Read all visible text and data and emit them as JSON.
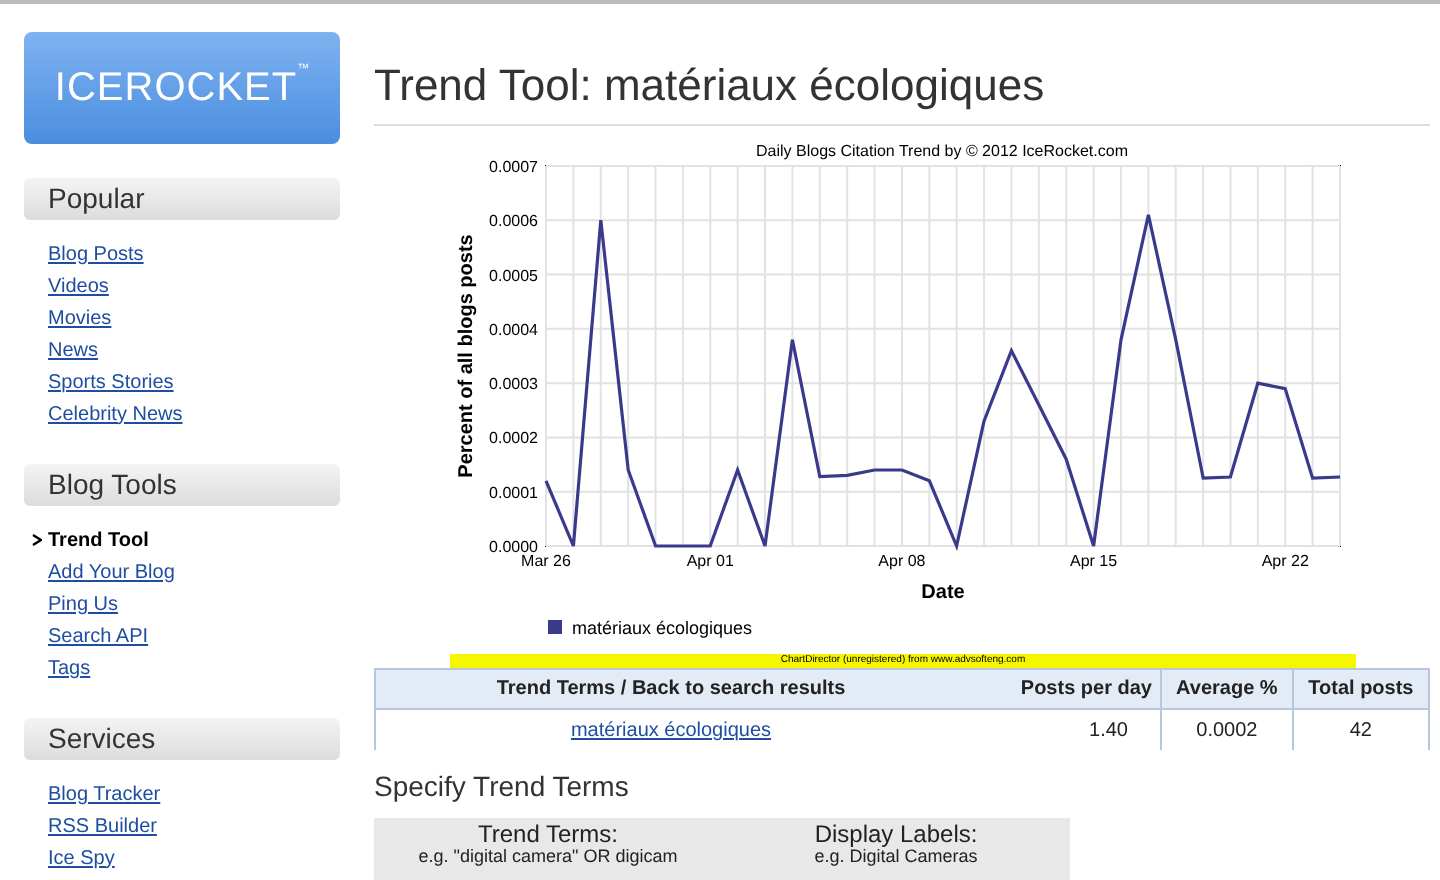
{
  "logo": {
    "text": "ICEROCKET",
    "mark": "™"
  },
  "sidebar": {
    "sections": [
      {
        "title": "Popular",
        "items": [
          {
            "label": "Blog Posts",
            "selected": false
          },
          {
            "label": "Videos",
            "selected": false
          },
          {
            "label": "Movies",
            "selected": false
          },
          {
            "label": "News",
            "selected": false
          },
          {
            "label": "Sports Stories",
            "selected": false
          },
          {
            "label": "Celebrity News",
            "selected": false
          }
        ]
      },
      {
        "title": "Blog Tools",
        "items": [
          {
            "label": "Trend Tool",
            "selected": true
          },
          {
            "label": "Add Your Blog",
            "selected": false
          },
          {
            "label": "Ping Us",
            "selected": false
          },
          {
            "label": "Search API",
            "selected": false
          },
          {
            "label": "Tags",
            "selected": false
          }
        ]
      },
      {
        "title": "Services",
        "items": [
          {
            "label": "Blog Tracker",
            "selected": false
          },
          {
            "label": "RSS Builder",
            "selected": false
          },
          {
            "label": "Ice Spy",
            "selected": false
          }
        ]
      }
    ]
  },
  "page_title": "Trend Tool: matériaux écologiques",
  "chart": {
    "chart_data": {
      "type": "line",
      "title": "Daily Blogs Citation Trend by © 2012 IceRocket.com",
      "xlabel": "Date",
      "ylabel": "Percent of all blogs posts",
      "categories": [
        "Mar 26",
        null,
        null,
        null,
        null,
        null,
        "Apr 01",
        null,
        null,
        null,
        null,
        null,
        null,
        "Apr 08",
        null,
        null,
        null,
        null,
        null,
        null,
        "Apr 15",
        null,
        null,
        null,
        null,
        null,
        null,
        "Apr 22",
        null,
        null
      ],
      "series": [
        {
          "name": "matériaux écologiques",
          "color": "#3a3a8c",
          "values": [
            0.00012,
            0.0,
            0.0006,
            0.00014,
            0.0,
            0.0,
            0.0,
            0.00014,
            0.0,
            0.00038,
            0.000128,
            0.00013,
            0.00014,
            0.00014,
            0.00012,
            0.0,
            0.00023,
            0.00036,
            0.00026,
            0.00016,
            0.0,
            0.00038,
            0.00061,
            0.00038,
            0.000125,
            0.000127,
            0.0003,
            0.00029,
            0.000125,
            0.000127
          ]
        }
      ],
      "ylim": [
        0,
        0.0007
      ],
      "grid": true,
      "yticks": [
        {
          "value": 0,
          "label": "0.0000"
        },
        {
          "value": 0.0001,
          "label": "0.0001"
        },
        {
          "value": 0.0002,
          "label": "0.0002"
        },
        {
          "value": 0.0003,
          "label": "0.0003"
        },
        {
          "value": 0.0004,
          "label": "0.0004"
        },
        {
          "value": 0.0005,
          "label": "0.0005"
        },
        {
          "value": 0.0006,
          "label": "0.0006"
        },
        {
          "value": 0.0007,
          "label": "0.0007"
        }
      ]
    },
    "banner": "ChartDirector (unregistered) from www.advsofteng.com"
  },
  "table": {
    "columns": [
      "Trend Terms / Back to search results",
      "Posts per day",
      "Average %",
      "Total posts"
    ],
    "rows": [
      {
        "term": "matériaux écologiques",
        "posts_per_day": "1.40",
        "average": "0.0002",
        "total": "42"
      }
    ]
  },
  "form": {
    "title": "Specify Trend Terms",
    "fields": [
      {
        "label": "Trend Terms:",
        "hint": "e.g. \"digital camera\" OR digicam"
      },
      {
        "label": "Display Labels:",
        "hint": "e.g. Digital Cameras"
      }
    ]
  }
}
